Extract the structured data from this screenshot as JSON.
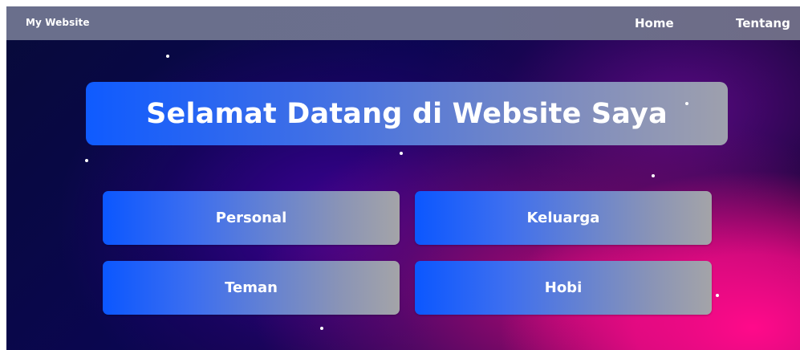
{
  "navbar": {
    "brand": "My Website",
    "links": [
      {
        "label": "Home"
      },
      {
        "label": "Tentang"
      }
    ]
  },
  "hero": {
    "title": "Selamat Datang di Website Saya"
  },
  "cards": [
    {
      "label": "Personal"
    },
    {
      "label": "Keluarga"
    },
    {
      "label": "Teman"
    },
    {
      "label": "Hobi"
    }
  ],
  "colors": {
    "accent_blue": "#0b57ff",
    "navbar": "#6b6f8d",
    "background_dark": "#0a0650",
    "background_pink": "#ff0a8a"
  }
}
